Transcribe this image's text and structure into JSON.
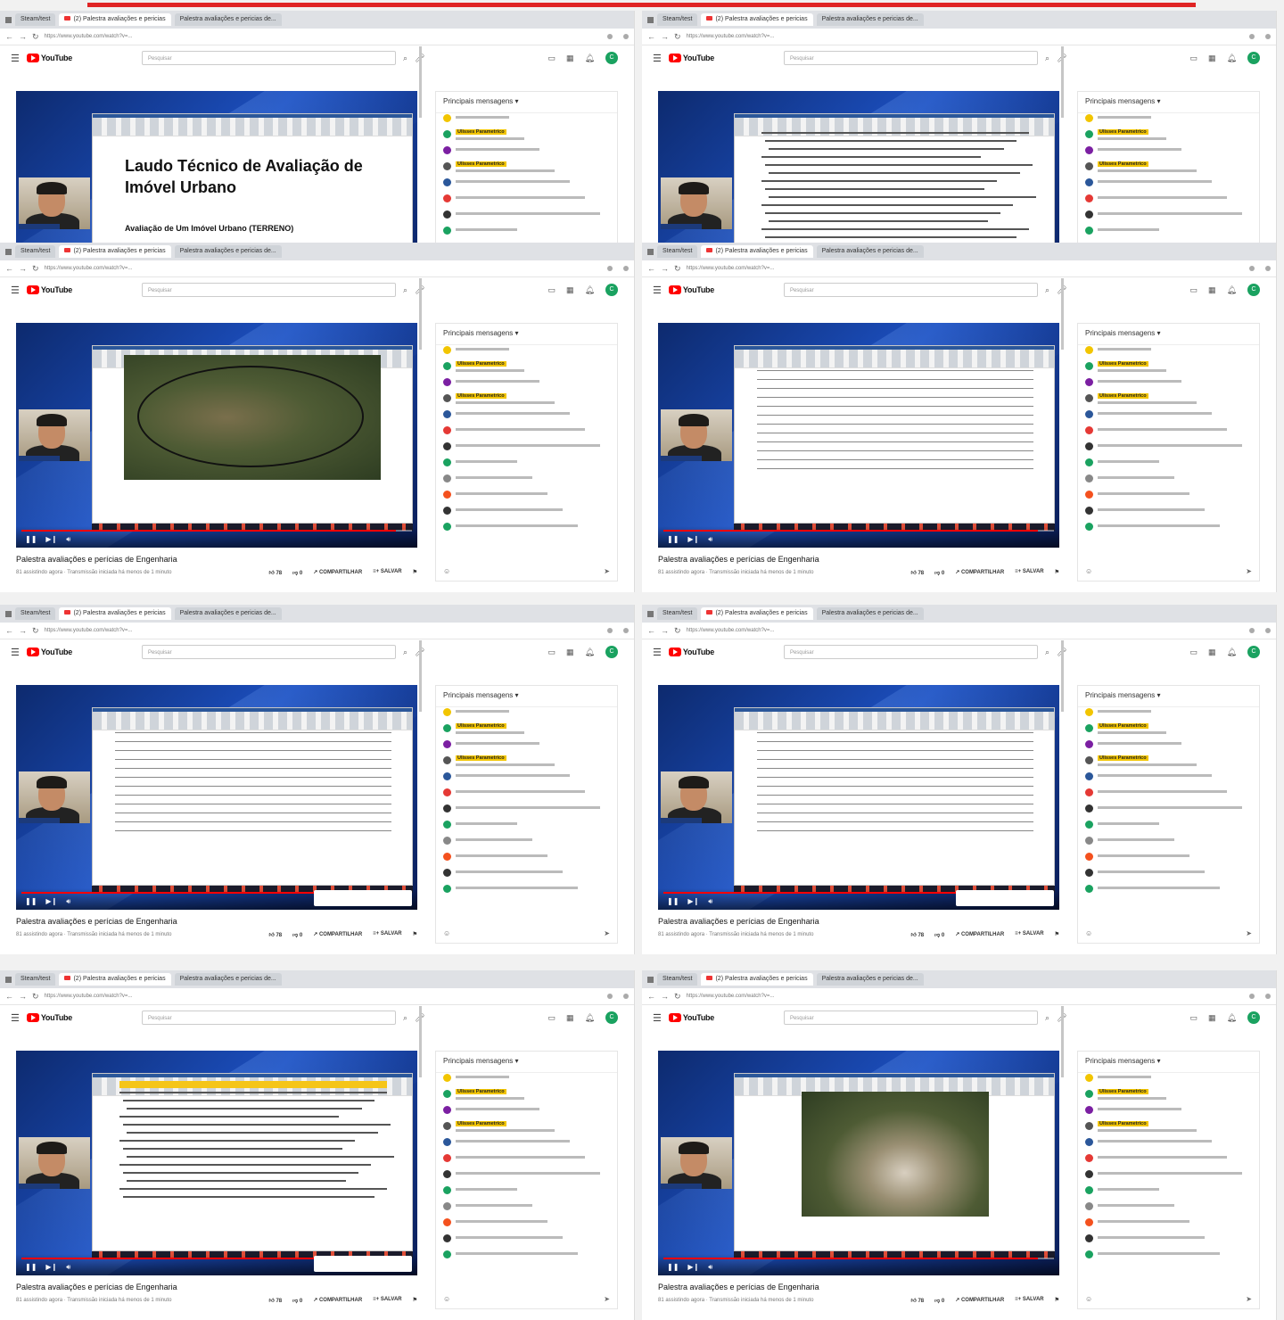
{
  "window": {
    "tabs": [
      "Steam/test",
      "(2) Palestra avaliações e pericias",
      "Palestra avaliações e pericias de..."
    ],
    "url": "https://www.youtube.com/watch?v=..."
  },
  "youtube": {
    "logo_text": "YouTube",
    "search_placeholder": "Pesquisar",
    "avatar_letter": "C"
  },
  "video": {
    "title": "Palestra avaliações e perícias de Engenharia",
    "meta": "81 assistindo agora · Transmissão iniciada há menos de 1 minuto",
    "likes": "78",
    "dislikes": "0",
    "share_label": "COMPARTILHAR",
    "save_label": "SALVAR"
  },
  "chat": {
    "header": "Principais mensagens",
    "highlight_name": "Ulisses Parametrico"
  },
  "slide1": {
    "title": "Laudo Técnico de Avaliação de Imóvel Urbano",
    "subtitle": "Avaliação de Um Imóvel Urbano (TERRENO)"
  },
  "panels": [
    {
      "view": "title"
    },
    {
      "view": "document"
    },
    {
      "view": "satellite-ellipse"
    },
    {
      "view": "table"
    },
    {
      "view": "formula-table"
    },
    {
      "view": "stats-table"
    },
    {
      "view": "executive-summary"
    },
    {
      "view": "satellite-site"
    }
  ]
}
